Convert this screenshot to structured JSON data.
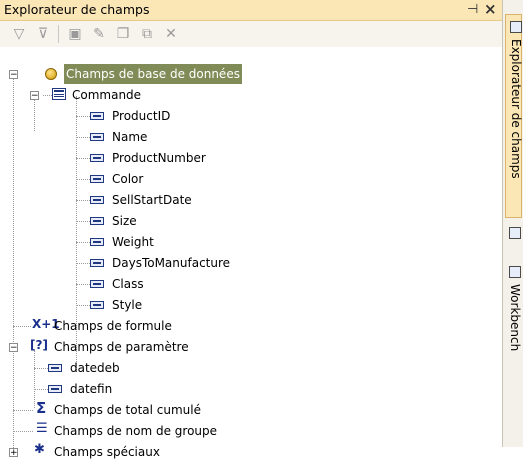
{
  "panel": {
    "title": "Explorateur de champs",
    "pin_glyph": "†",
    "close_glyph": "×"
  },
  "toolbar": {
    "icons": [
      "filter-icon",
      "filter-config-icon",
      "new-icon",
      "edit-icon",
      "copy-icon",
      "duplicate-icon",
      "delete-icon"
    ]
  },
  "tree": {
    "db_fields": "Champs de base de données",
    "command": "Commande",
    "fields": [
      "ProductID",
      "Name",
      "ProductNumber",
      "Color",
      "SellStartDate",
      "Size",
      "Weight",
      "DaysToManufacture",
      "Class",
      "Style"
    ],
    "formula_fields": "Champs de formule",
    "parameter_fields": "Champs de paramètre",
    "parameters": [
      "datedeb",
      "datefin"
    ],
    "running_total_fields": "Champs de total cumulé",
    "group_name_fields": "Champs de nom de groupe",
    "special_fields": "Champs spéciaux",
    "formula_icon_text": "X+1",
    "param_icon_text": "[?]",
    "sigma_icon_text": "Σ"
  },
  "sidebar": {
    "tabs": [
      "Explorateur de champs",
      "Workbench"
    ]
  },
  "colors": {
    "titlebar": "#fbe6b6",
    "selection": "#808c58"
  }
}
